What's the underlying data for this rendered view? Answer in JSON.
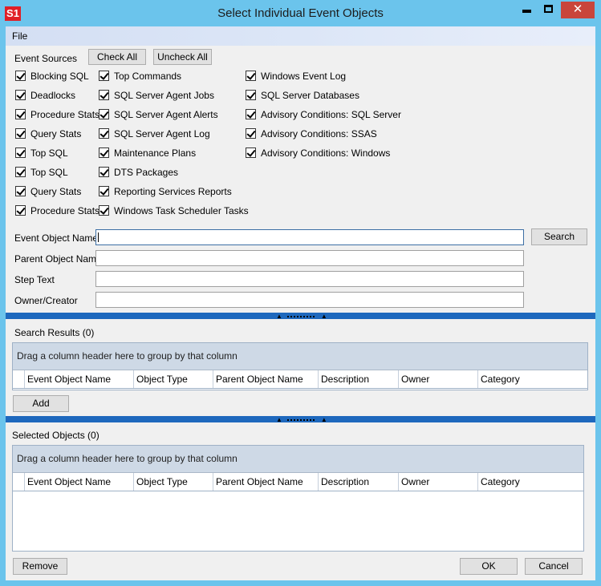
{
  "window": {
    "icon_text": "S1",
    "title": "Select Individual Event Objects",
    "close_glyph": "✕"
  },
  "menu": {
    "file": "File"
  },
  "event_sources": {
    "label": "Event Sources",
    "check_all": "Check All",
    "uncheck_all": "Uncheck All",
    "col1": [
      {
        "label": "Blocking SQL",
        "checked": true
      },
      {
        "label": "Deadlocks",
        "checked": true
      },
      {
        "label": "Procedure Stats",
        "checked": true
      },
      {
        "label": "Query Stats",
        "checked": true
      },
      {
        "label": "Top SQL",
        "checked": true
      },
      {
        "label": "Top SQL",
        "checked": true
      },
      {
        "label": "Query Stats",
        "checked": true
      },
      {
        "label": "Procedure Stats",
        "checked": true
      }
    ],
    "col2": [
      {
        "label": "Top Commands",
        "checked": true
      },
      {
        "label": "SQL Server Agent Jobs",
        "checked": true
      },
      {
        "label": "SQL Server Agent Alerts",
        "checked": true
      },
      {
        "label": "SQL Server Agent Log",
        "checked": true
      },
      {
        "label": "Maintenance Plans",
        "checked": true
      },
      {
        "label": "DTS Packages",
        "checked": true
      },
      {
        "label": "Reporting Services Reports",
        "checked": true
      },
      {
        "label": "Windows Task Scheduler Tasks",
        "checked": true
      }
    ],
    "col3": [
      {
        "label": "Windows Event Log",
        "checked": true
      },
      {
        "label": "SQL Server Databases",
        "checked": true
      },
      {
        "label": "Advisory Conditions: SQL Server",
        "checked": true
      },
      {
        "label": "Advisory Conditions: SSAS",
        "checked": true
      },
      {
        "label": "Advisory Conditions: Windows",
        "checked": true
      }
    ]
  },
  "fields": {
    "event_object_name": {
      "label": "Event Object Name",
      "value": ""
    },
    "parent_object_name": {
      "label": "Parent Object Name",
      "value": ""
    },
    "step_text": {
      "label": "Step Text",
      "value": ""
    },
    "owner_creator": {
      "label": "Owner/Creator",
      "value": ""
    },
    "search_button": "Search"
  },
  "search_results": {
    "label": "Search Results (0)",
    "group_hint": "Drag a column header here to group by that column",
    "columns": [
      "Event Object Name",
      "Object Type",
      "Parent Object Name",
      "Description",
      "Owner",
      "Category"
    ],
    "add_button": "Add"
  },
  "selected_objects": {
    "label": "Selected Objects (0)",
    "group_hint": "Drag a column header here to group by that column",
    "columns": [
      "Event Object Name",
      "Object Type",
      "Parent Object Name",
      "Description",
      "Owner",
      "Category"
    ]
  },
  "footer": {
    "remove": "Remove",
    "ok": "OK",
    "cancel": "Cancel"
  },
  "colors": {
    "window_frame": "#6bc4ec",
    "close_button": "#c9453b",
    "splitter": "#1e68bd",
    "group_panel": "#ced9e6"
  }
}
